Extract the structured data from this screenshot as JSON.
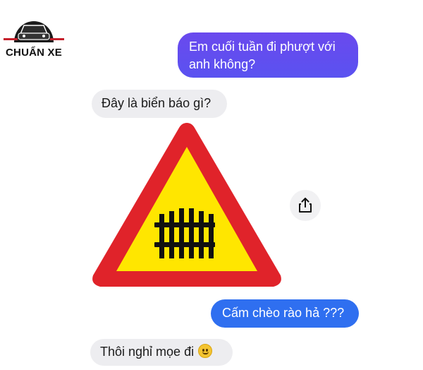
{
  "logo": {
    "brand_text": "CHUẨN XE"
  },
  "conversation": {
    "messages": [
      {
        "direction": "outgoing",
        "text": "Em cuối tuần đi phượt với anh không?"
      },
      {
        "direction": "incoming",
        "text": "Đây là biển báo gì?"
      },
      {
        "direction": "incoming",
        "type": "image",
        "icon": "railway-fence-warning-sign"
      },
      {
        "direction": "outgoing",
        "text": "Cấm chèo rào hả ???"
      },
      {
        "direction": "incoming",
        "text": "Thôi nghỉ mọe đi",
        "emoji": "slightly-smiling-face"
      }
    ]
  },
  "actions": {
    "share_icon": "share-icon"
  },
  "colors": {
    "outgoing_bubble": "#5a4ff0",
    "outgoing_bubble_blue": "#2f6ff0",
    "incoming_bubble": "#ededf0",
    "sign_border": "#e0232a",
    "sign_fill": "#ffe600"
  }
}
